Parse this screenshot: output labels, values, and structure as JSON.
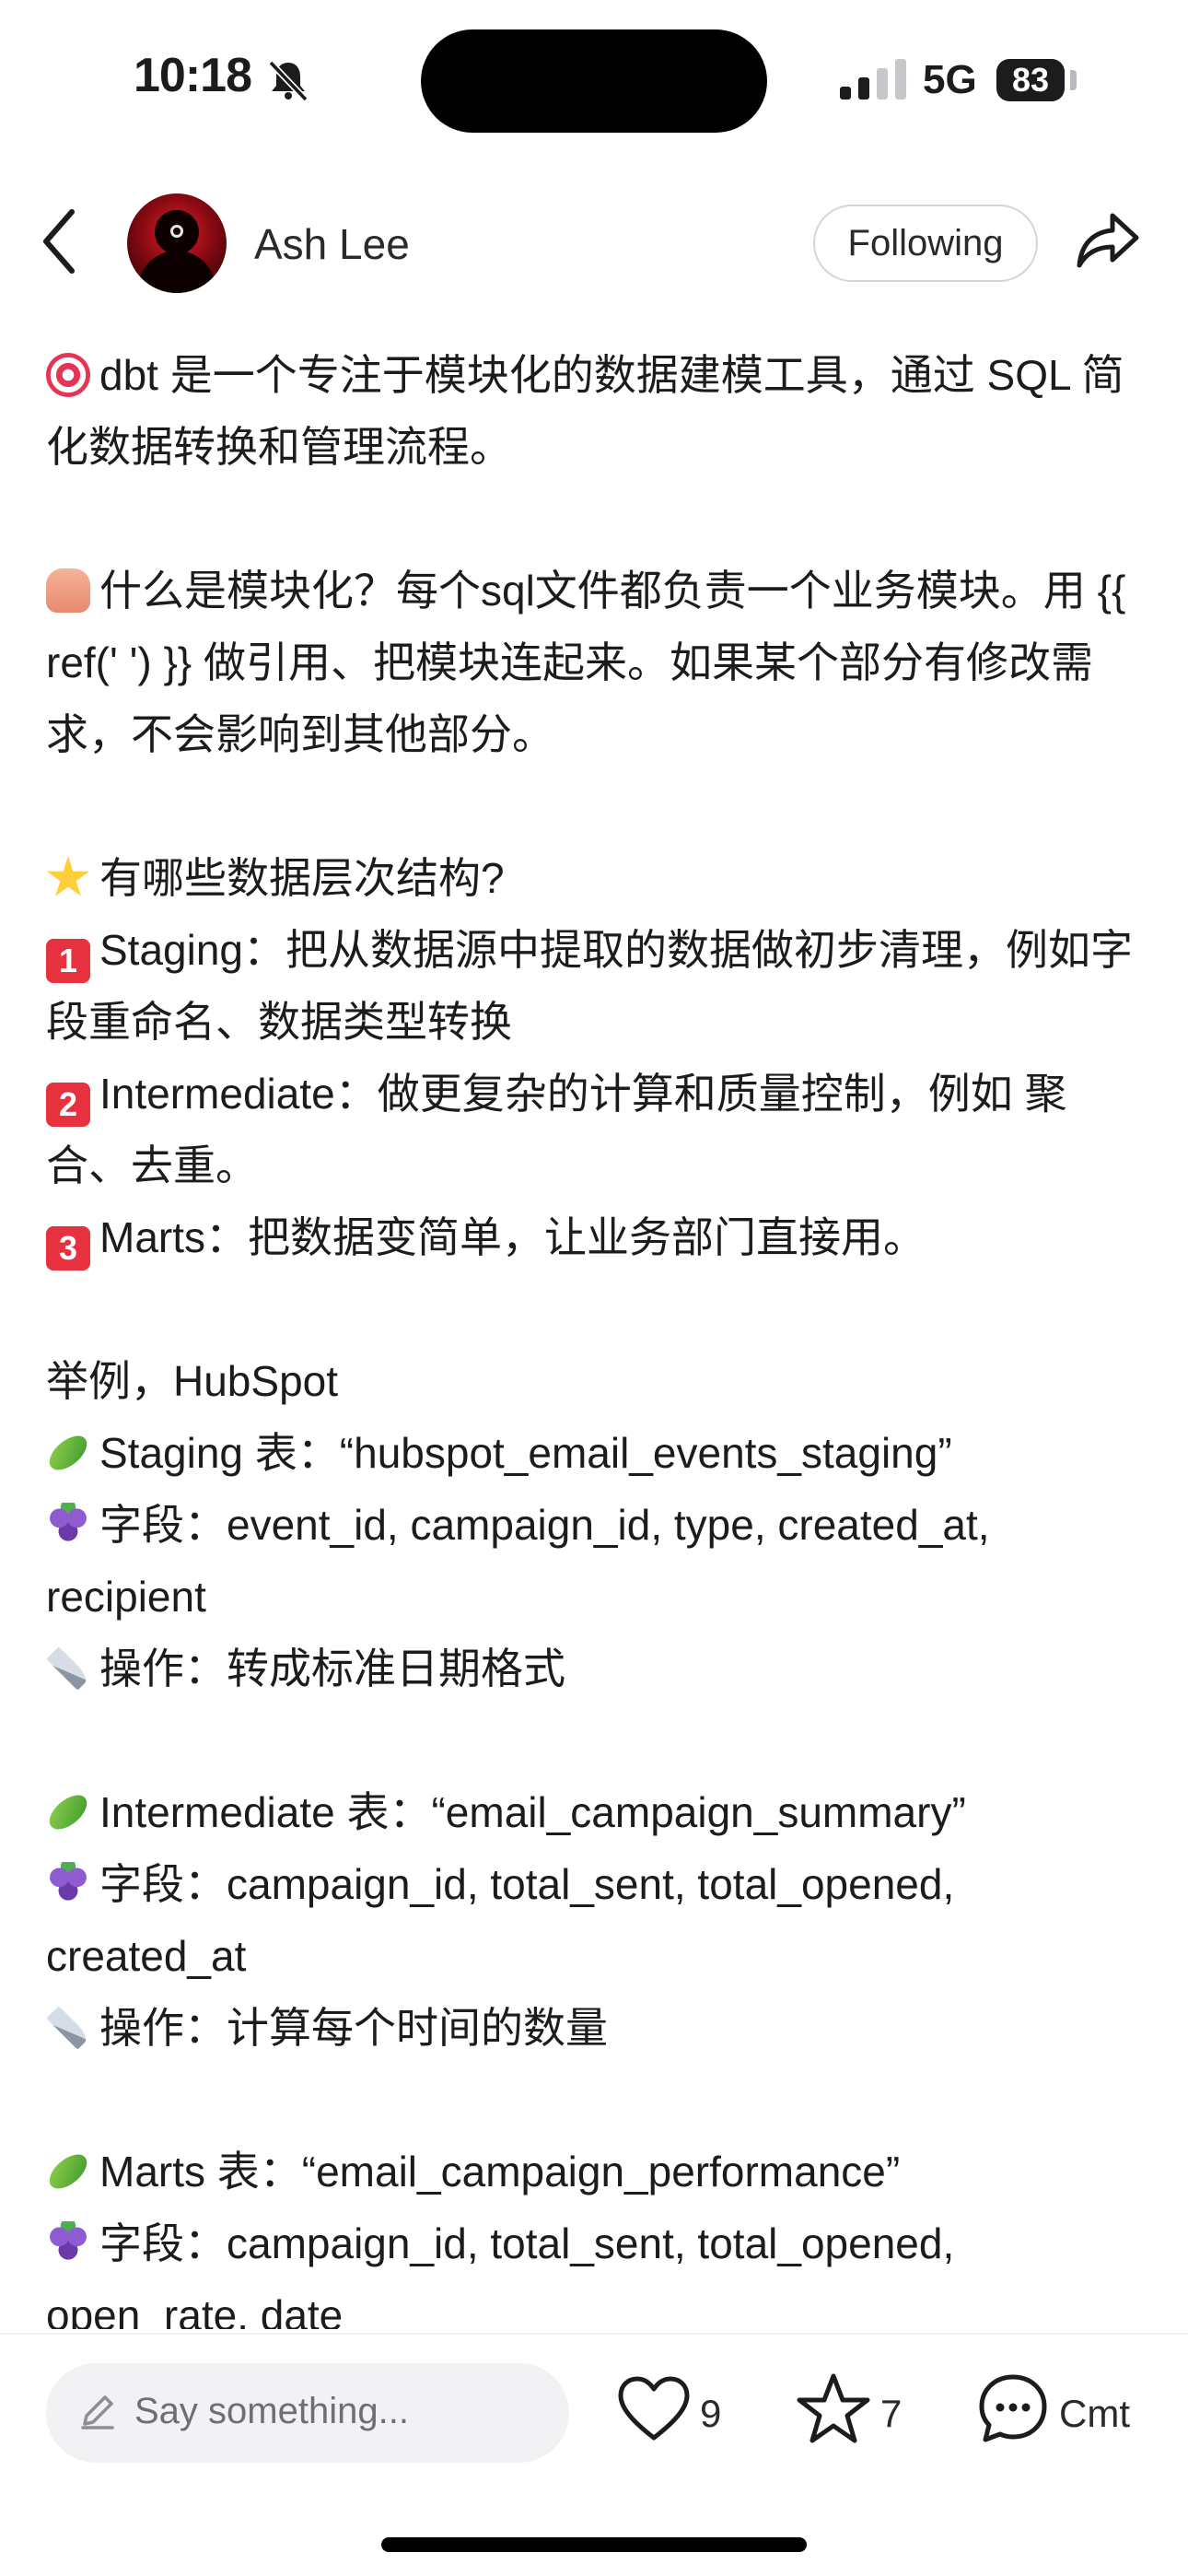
{
  "status_bar": {
    "time": "10:18",
    "network": "5G",
    "battery": "83"
  },
  "header": {
    "author": "Ash Lee",
    "follow_label": "Following"
  },
  "post": {
    "lines": [
      {
        "emoji": "target",
        "text": "dbt 是一个专注于模块化的数据建模工具，通过 SQL 简化数据转换和管理流程。"
      },
      {
        "gap": true
      },
      {
        "emoji": "thumb",
        "text": "什么是模块化？每个sql文件都负责一个业务模块。用 {{ ref(' ') }}  做引用、把模块连起来。如果某个部分有修改需求，不会影响到其他部分。"
      },
      {
        "gap": true
      },
      {
        "emoji": "star",
        "text": "有哪些数据层次结构?"
      },
      {
        "emoji": "num",
        "num": "1",
        "text": "Staging：把从数据源中提取的数据做初步清理，例如字段重命名、数据类型转换"
      },
      {
        "emoji": "num",
        "num": "2",
        "text": "Intermediate：做更复杂的计算和质量控制，例如 聚合、去重。"
      },
      {
        "emoji": "num",
        "num": "3",
        "text": "Marts：把数据变简单，让业务部门直接用。"
      },
      {
        "gap": true
      },
      {
        "emoji": "",
        "text": "举例，HubSpot"
      },
      {
        "emoji": "cucumber",
        "text": "Staging 表：“hubspot_email_events_staging”"
      },
      {
        "emoji": "grapes",
        "text": "字段：event_id, campaign_id, type, created_at, recipient"
      },
      {
        "emoji": "knife",
        "text": "操作：转成标准日期格式"
      },
      {
        "gap": true
      },
      {
        "emoji": "cucumber",
        "text": "Intermediate 表：“email_campaign_summary”"
      },
      {
        "emoji": "grapes",
        "text": "字段：campaign_id, total_sent, total_opened, created_at"
      },
      {
        "emoji": "knife",
        "text": "操作：计算每个时间的数量"
      },
      {
        "gap": true
      },
      {
        "emoji": "cucumber",
        "text": "Marts 表：“email_campaign_performance”"
      },
      {
        "emoji": "grapes",
        "text": "字段：campaign_id, total_sent, total_opened, open_rate, date"
      }
    ]
  },
  "bottom_bar": {
    "comment_placeholder": "Say something...",
    "likes": "9",
    "stars": "7",
    "comment_label": "Cmt"
  },
  "icons": [
    "back-icon",
    "share-icon",
    "pencil-icon",
    "heart-icon",
    "star-icon",
    "comment-icon",
    "bell-slash-icon",
    "signal-icon"
  ]
}
